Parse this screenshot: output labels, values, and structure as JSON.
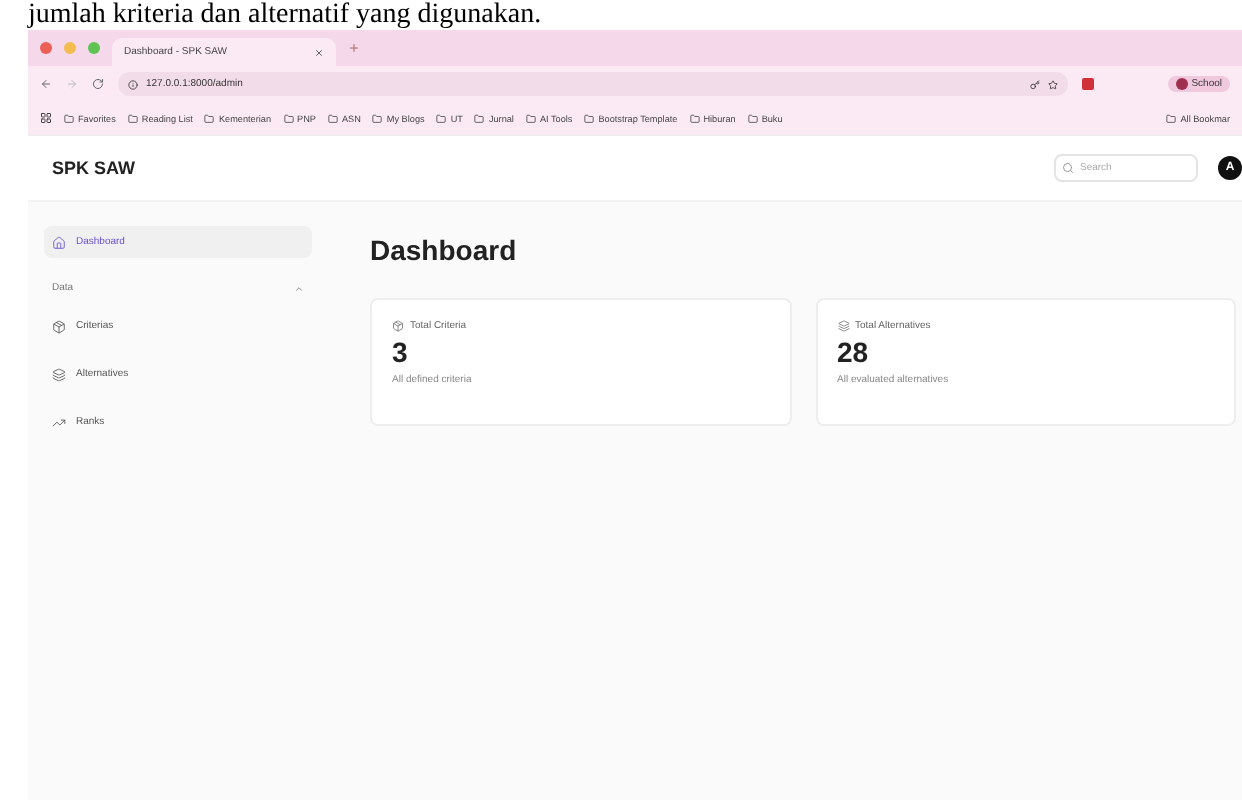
{
  "caption": "jumlah kriteria dan alternatif yang digunakan.",
  "browser": {
    "tab_title": "Dashboard - SPK SAW",
    "url": "127.0.0.1:8000/admin",
    "profile": "School",
    "bookmarks": [
      "Favorites",
      "Reading List",
      "Kementerian",
      "PNP",
      "ASN",
      "My Blogs",
      "UT",
      "Jurnal",
      "AI Tools",
      "Bootstrap Template",
      "Hiburan",
      "Buku"
    ],
    "all_bookmarks": "All Bookmar"
  },
  "app": {
    "brand": "SPK SAW",
    "search": {
      "placeholder": "Search"
    },
    "avatar": "A"
  },
  "sidebar": {
    "items": [
      {
        "label": "Dashboard",
        "kind": "home",
        "selected": true
      }
    ],
    "group": "Data",
    "group_items": [
      {
        "label": "Criterias",
        "kind": "box",
        "selected": false
      },
      {
        "label": "Alternatives",
        "kind": "layers",
        "selected": false
      },
      {
        "label": "Ranks",
        "kind": "trend",
        "selected": false
      }
    ]
  },
  "page_title": "Dashboard",
  "stats": [
    {
      "label": "Total Criteria",
      "kind": "box",
      "value": "3",
      "description": "All defined criteria"
    },
    {
      "label": "Total Alternatives",
      "kind": "layers",
      "value": "28",
      "description": "All evaluated alternatives"
    }
  ]
}
